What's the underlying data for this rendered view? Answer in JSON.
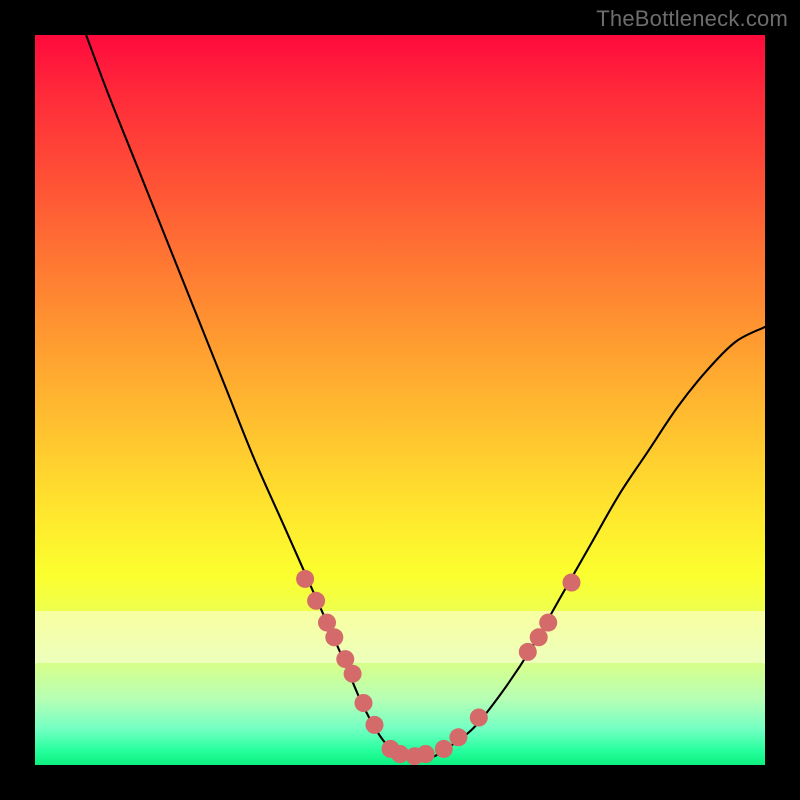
{
  "watermark": {
    "text": "TheBottleneck.com"
  },
  "chart_data": {
    "type": "line",
    "title": "",
    "xlabel": "",
    "ylabel": "",
    "xlim": [
      0,
      1
    ],
    "ylim": [
      0,
      1
    ],
    "grid": false,
    "legend": null,
    "background": "rainbow-gradient",
    "series": [
      {
        "name": "bottleneck-curve",
        "color": "#000000",
        "x": [
          0.07,
          0.1,
          0.14,
          0.18,
          0.22,
          0.26,
          0.3,
          0.34,
          0.38,
          0.42,
          0.45,
          0.48,
          0.51,
          0.54,
          0.56,
          0.6,
          0.64,
          0.68,
          0.72,
          0.76,
          0.8,
          0.84,
          0.88,
          0.92,
          0.96,
          1.0
        ],
        "values": [
          1.0,
          0.92,
          0.82,
          0.72,
          0.62,
          0.52,
          0.42,
          0.33,
          0.24,
          0.15,
          0.08,
          0.03,
          0.01,
          0.01,
          0.02,
          0.05,
          0.1,
          0.16,
          0.23,
          0.3,
          0.37,
          0.43,
          0.49,
          0.54,
          0.58,
          0.6
        ]
      }
    ],
    "scatter_overlay": {
      "name": "highlight-dots",
      "color": "#d46a6a",
      "radius_px": 9,
      "points": [
        {
          "x": 0.37,
          "y": 0.255
        },
        {
          "x": 0.385,
          "y": 0.225
        },
        {
          "x": 0.4,
          "y": 0.195
        },
        {
          "x": 0.41,
          "y": 0.175
        },
        {
          "x": 0.425,
          "y": 0.145
        },
        {
          "x": 0.435,
          "y": 0.125
        },
        {
          "x": 0.45,
          "y": 0.085
        },
        {
          "x": 0.465,
          "y": 0.055
        },
        {
          "x": 0.487,
          "y": 0.022
        },
        {
          "x": 0.5,
          "y": 0.015
        },
        {
          "x": 0.52,
          "y": 0.012
        },
        {
          "x": 0.535,
          "y": 0.015
        },
        {
          "x": 0.56,
          "y": 0.022
        },
        {
          "x": 0.58,
          "y": 0.038
        },
        {
          "x": 0.608,
          "y": 0.065
        },
        {
          "x": 0.675,
          "y": 0.155
        },
        {
          "x": 0.69,
          "y": 0.175
        },
        {
          "x": 0.703,
          "y": 0.195
        },
        {
          "x": 0.735,
          "y": 0.25
        }
      ]
    }
  }
}
